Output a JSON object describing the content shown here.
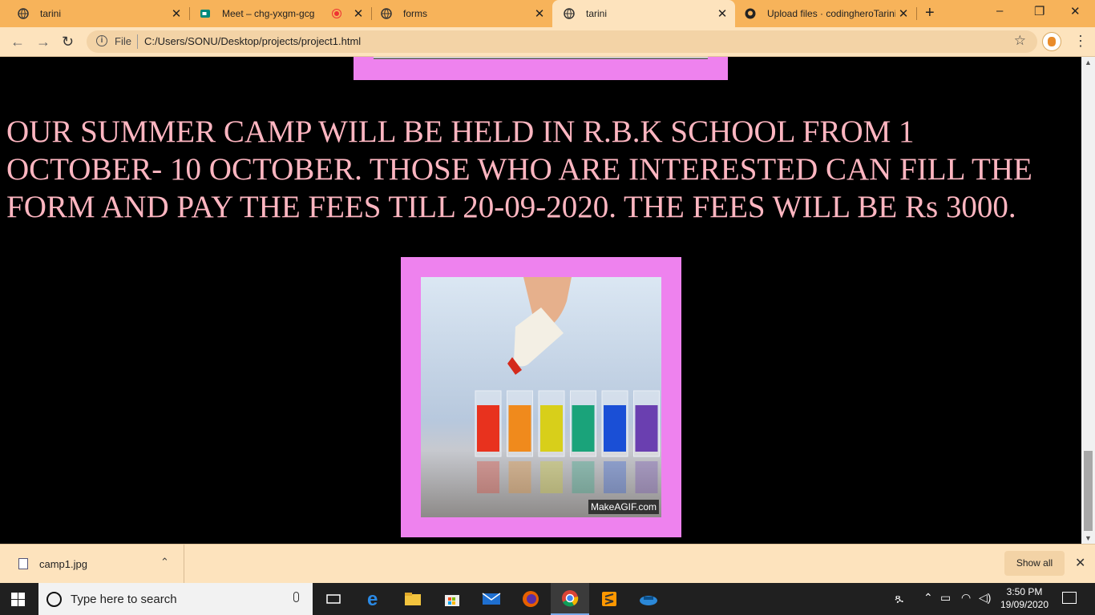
{
  "browser": {
    "tabs": [
      {
        "title": "tarini",
        "active": false
      },
      {
        "title": "Meet – chg-yxgm-gcg",
        "active": false,
        "recording": true
      },
      {
        "title": "forms",
        "active": false
      },
      {
        "title": "tarini",
        "active": true
      },
      {
        "title": "Upload files · codingheroTarini",
        "active": false
      }
    ],
    "new_tab_symbol": "+",
    "window_controls": {
      "minimize": "–",
      "restore": "❐",
      "close": "✕"
    },
    "nav": {
      "back": "←",
      "forward": "→",
      "reload": "↻"
    },
    "address": {
      "scheme_label": "File",
      "url": "C:/Users/SONU/Desktop/projects/project1.html",
      "info_glyph": "i",
      "star_glyph": "☆"
    },
    "menu_glyph": "⋮"
  },
  "page": {
    "notice_text": "OUR SUMMER CAMP WILL BE HELD IN R.B.K SCHOOL FROM 1 OCTOBER- 10 OCTOBER. THOSE WHO ARE INTERESTED CAN FILL THE FORM AND PAY THE FEES TILL 20-09-2020. THE FEES WILL BE Rs 3000.",
    "image_watermark": "MakeAGIF.com",
    "glass_colors": [
      "#e8321e",
      "#f08a1c",
      "#d8cf1a",
      "#1aa37a",
      "#1a4fd6",
      "#6a3fb0"
    ],
    "frame_color": "#ee82ee",
    "text_color": "#ffb6c1"
  },
  "downloads": {
    "file_name": "camp1.jpg",
    "chevron": "⌃",
    "show_all_label": "Show all",
    "close_glyph": "✕"
  },
  "taskbar": {
    "search_placeholder": "Type here to search",
    "time": "3:50 PM",
    "date": "19/09/2020"
  }
}
